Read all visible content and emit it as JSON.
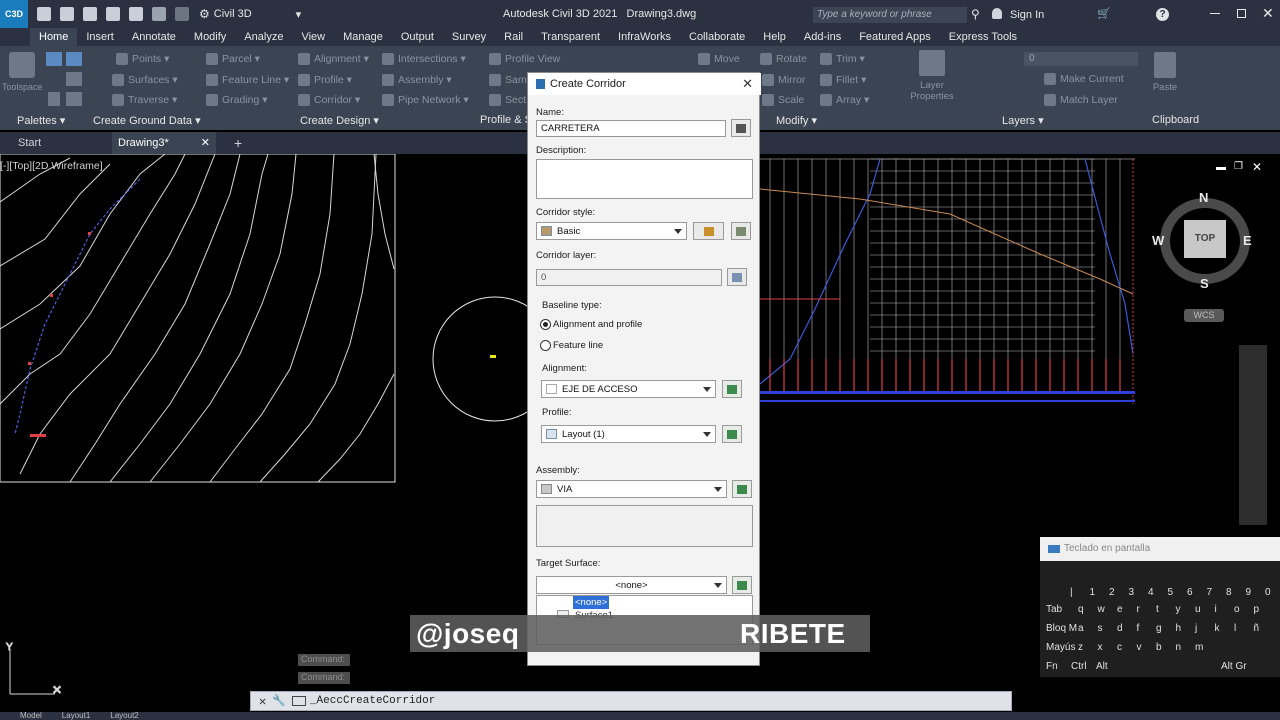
{
  "titlebar": {
    "workspace": "Civil 3D",
    "app_title": "Autodesk Civil 3D 2021",
    "drawing": "Drawing3.dwg",
    "search_placeholder": "Type a keyword or phrase",
    "sign_in": "Sign In",
    "logo_text": "C3D"
  },
  "ribbon_tabs": [
    "Home",
    "Insert",
    "Annotate",
    "Modify",
    "Analyze",
    "View",
    "Manage",
    "Output",
    "Survey",
    "Rail",
    "Transparent",
    "InfraWorks",
    "Collaborate",
    "Help",
    "Add-ins",
    "Featured Apps",
    "Express Tools"
  ],
  "ribbon": {
    "tools_col1": [
      "Points",
      "Surfaces",
      "Traverse"
    ],
    "tools_col2": [
      "Parcel",
      "Feature Line",
      "Grading"
    ],
    "tools_col3": [
      "Alignment",
      "Profile",
      "Corridor"
    ],
    "tools_col4": [
      "Intersections",
      "Assembly",
      "Pipe Network"
    ],
    "tools_col5": [
      "Profile View",
      "Sam",
      "Sect"
    ],
    "tools_modify_a": [
      "Move",
      "Mirror",
      "Scale"
    ],
    "tools_modify_b": [
      "Rotate",
      "Fillet",
      "Array"
    ],
    "tools_modify_c": [
      "Trim"
    ],
    "layer_value": "0",
    "layer_props": "Layer Properties",
    "make_current": "Make Current",
    "match_layer": "Match Layer",
    "paste": "Paste",
    "toolspace": "Toolspace",
    "groups": {
      "palettes": "Palettes",
      "create_ground": "Create Ground Data",
      "create_design": "Create Design",
      "profile_sec": "Profile & S",
      "modify": "Modify",
      "layers": "Layers",
      "clipboard": "Clipboard"
    }
  },
  "file_tabs": {
    "start": "Start",
    "drawing": "Drawing3*"
  },
  "viewport_label": "[-][Top][2D Wireframe]",
  "viewcube": {
    "n": "N",
    "s": "S",
    "e": "E",
    "w": "W",
    "top": "TOP",
    "wcs": "WCS"
  },
  "dialog": {
    "title": "Create Corridor",
    "name_label": "Name:",
    "name_value": "CARRETERA",
    "description_label": "Description:",
    "style_label": "Corridor style:",
    "style_value": "Basic",
    "layer_label": "Corridor layer:",
    "layer_value": "0",
    "baseline_label": "Baseline type:",
    "radio_alignment": "Alignment and profile",
    "radio_feature": "Feature line",
    "alignment_label": "Alignment:",
    "alignment_value": "EJE DE ACCESO",
    "profile_label": "Profile:",
    "profile_value": "Layout (1)",
    "assembly_label": "Assembly:",
    "assembly_value": "VIA",
    "target_label": "Target Surface:",
    "target_value": "<none>",
    "dropdown_options": [
      "<none>",
      "Surface1"
    ]
  },
  "watermark": "@joseq",
  "watermark_tail": "RIBETE",
  "command": {
    "prompt1": "Command:",
    "prompt2": "Command:",
    "current": "_AeccCreateCorridor"
  },
  "osk": {
    "title": "Teclado en pantalla",
    "row1": [
      "|",
      "1",
      "2",
      "3",
      "4",
      "5",
      "6",
      "7",
      "8",
      "9",
      "0"
    ],
    "row2": [
      "Tab",
      "q",
      "w",
      "e",
      "r",
      "t",
      "y",
      "u",
      "i",
      "o",
      "p"
    ],
    "row3": [
      "Bloq M",
      "a",
      "s",
      "d",
      "f",
      "g",
      "h",
      "j",
      "k",
      "l",
      "ñ"
    ],
    "row4": [
      "Mayús",
      "z",
      "x",
      "c",
      "v",
      "b",
      "n",
      "m"
    ],
    "row5": [
      "Fn",
      "Ctrl",
      "Alt",
      "Alt Gr"
    ]
  },
  "layout_tabs": [
    "Model",
    "Layout1",
    "Layout2"
  ]
}
